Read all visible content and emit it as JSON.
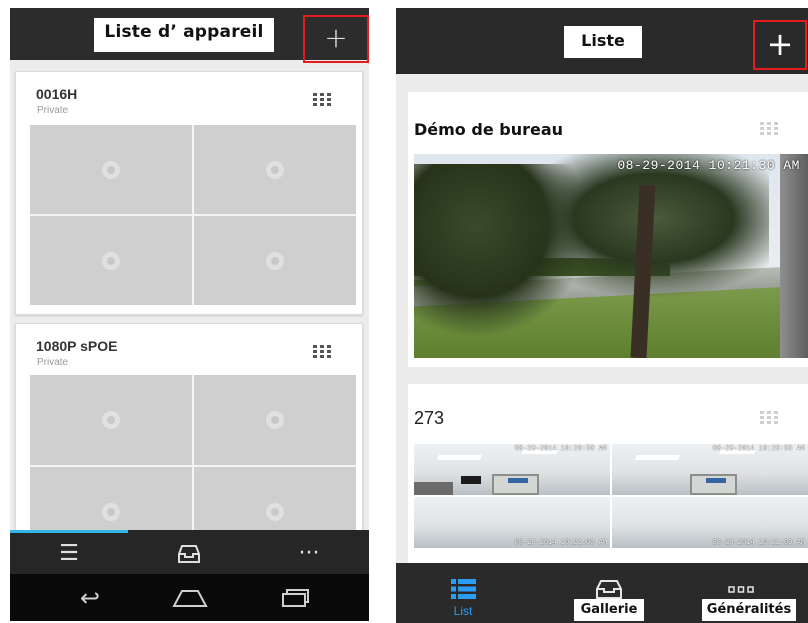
{
  "left_screen": {
    "header": {
      "title": "Liste d’  appareil",
      "add_label": "+"
    },
    "devices": [
      {
        "name": "0016H",
        "subtitle": "Private"
      },
      {
        "name": "1080P sPOE",
        "subtitle": "Private"
      }
    ],
    "tabbar": {
      "list_icon": "☰",
      "gallery_icon": "⌂",
      "more_icon": "···"
    },
    "navbar": {
      "back_icon": "↩",
      "home_icon": "⌂",
      "recents_icon": "▭"
    }
  },
  "right_screen": {
    "header": {
      "title": "Liste",
      "add_label": "+"
    },
    "devices": [
      {
        "name": "Démo de bureau",
        "timestamp": "08-29-2014 10:21:30 AM"
      },
      {
        "name": "273",
        "timestamps": [
          "08-29-2014 10:20:50 AM",
          "08-29-2014 10:20:58 AM",
          "08-29-2014 10:21:00 AM",
          "08-29-2014 10:21:00 AM"
        ]
      }
    ],
    "tabbar": {
      "tabs": [
        {
          "label": "List",
          "icon": "list-icon",
          "active": true
        },
        {
          "label": "Gallerie",
          "icon": "gallery-icon",
          "active": false
        },
        {
          "label": "Généralités",
          "icon": "more-icon",
          "active": false
        }
      ]
    }
  },
  "colors": {
    "highlight_box": "#e41b1b",
    "active_tab": "#2a9df4",
    "header_bg": "#2a2a2a"
  }
}
